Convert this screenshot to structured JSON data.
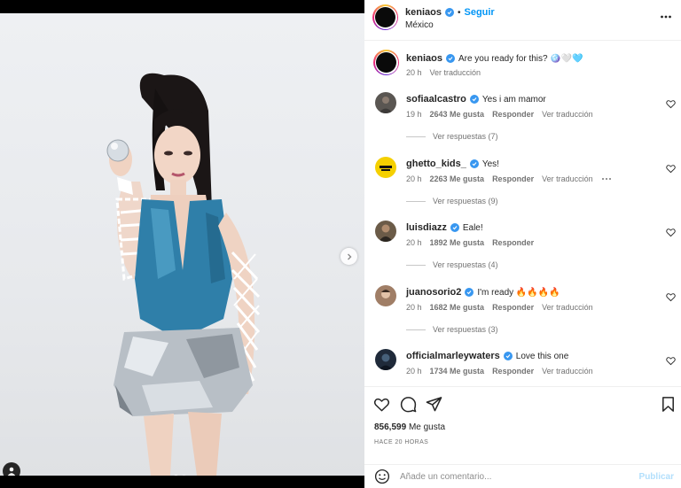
{
  "post": {
    "author": "keniaos",
    "follow_label": "Seguir",
    "bullet": "•",
    "location": "México"
  },
  "caption": {
    "username": "keniaos",
    "text": "Are you ready for this? 🪩🤍🩵",
    "time": "20 h",
    "translate_label": "Ver traducción"
  },
  "comments": [
    {
      "username": "sofiaalcastro",
      "text": "Yes i am mamor",
      "time": "19 h",
      "likes": "2643 Me gusta",
      "reply_label": "Responder",
      "translate_label": "Ver traducción",
      "replies_label": "Ver respuestas (7)",
      "avatar_color": "#5a5652"
    },
    {
      "username": "ghetto_kids_",
      "text": "Yes!",
      "time": "20 h",
      "likes": "2263 Me gusta",
      "reply_label": "Responder",
      "translate_label": "Ver traducción",
      "replies_label": "Ver respuestas (9)",
      "avatar_color": "#f5d000"
    },
    {
      "username": "luisdiazz",
      "text": "Eale!",
      "time": "20 h",
      "likes": "1892 Me gusta",
      "reply_label": "Responder",
      "translate_label": "",
      "replies_label": "Ver respuestas (4)",
      "avatar_color": "#6b5b48"
    },
    {
      "username": "juanosorio2",
      "text": "I'm ready 🔥🔥🔥🔥",
      "time": "20 h",
      "likes": "1682 Me gusta",
      "reply_label": "Responder",
      "translate_label": "Ver traducción",
      "replies_label": "Ver respuestas (3)",
      "avatar_color": "#a07e66"
    },
    {
      "username": "officialmarleywaters",
      "text": "Love this one",
      "time": "20 h",
      "likes": "1734 Me gusta",
      "reply_label": "Responder",
      "translate_label": "Ver traducción",
      "replies_label": "",
      "avatar_color": "#1f2a3a"
    }
  ],
  "actions": {
    "likes_count": "856,599",
    "likes_suffix": "Me gusta",
    "time_ago": "HACE 20 HORAS",
    "comment_placeholder": "Añade un comentario...",
    "publish_label": "Publicar"
  },
  "icons": {
    "more": "more-options-icon",
    "verified": "verified-badge-icon",
    "heart": "heart-icon",
    "comment": "comment-icon",
    "share": "share-icon",
    "save": "bookmark-icon",
    "emoji": "emoji-icon",
    "next": "chevron-right-icon",
    "tag": "user-tag-icon"
  },
  "colors": {
    "accent": "#0095f6",
    "verified": "#3897f0",
    "muted_text": "#737373",
    "publish_disabled": "#b2dffc"
  }
}
